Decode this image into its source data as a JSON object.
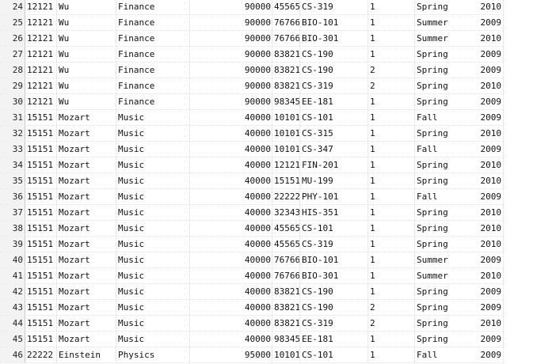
{
  "grid": {
    "rows": [
      {
        "rn": "24",
        "id": "12121",
        "name": "Wu",
        "dept": "Finance",
        "salary": "90000",
        "sid": "45565",
        "course": "CS-319",
        "sec": "1",
        "semester": "Spring",
        "year": "2010"
      },
      {
        "rn": "25",
        "id": "12121",
        "name": "Wu",
        "dept": "Finance",
        "salary": "90000",
        "sid": "76766",
        "course": "BIO-101",
        "sec": "1",
        "semester": "Summer",
        "year": "2009"
      },
      {
        "rn": "26",
        "id": "12121",
        "name": "Wu",
        "dept": "Finance",
        "salary": "90000",
        "sid": "76766",
        "course": "BIO-301",
        "sec": "1",
        "semester": "Summer",
        "year": "2010"
      },
      {
        "rn": "27",
        "id": "12121",
        "name": "Wu",
        "dept": "Finance",
        "salary": "90000",
        "sid": "83821",
        "course": "CS-190",
        "sec": "1",
        "semester": "Spring",
        "year": "2009"
      },
      {
        "rn": "28",
        "id": "12121",
        "name": "Wu",
        "dept": "Finance",
        "salary": "90000",
        "sid": "83821",
        "course": "CS-190",
        "sec": "2",
        "semester": "Spring",
        "year": "2009"
      },
      {
        "rn": "29",
        "id": "12121",
        "name": "Wu",
        "dept": "Finance",
        "salary": "90000",
        "sid": "83821",
        "course": "CS-319",
        "sec": "2",
        "semester": "Spring",
        "year": "2010"
      },
      {
        "rn": "30",
        "id": "12121",
        "name": "Wu",
        "dept": "Finance",
        "salary": "90000",
        "sid": "98345",
        "course": "EE-181",
        "sec": "1",
        "semester": "Spring",
        "year": "2009"
      },
      {
        "rn": "31",
        "id": "15151",
        "name": "Mozart",
        "dept": "Music",
        "salary": "40000",
        "sid": "10101",
        "course": "CS-101",
        "sec": "1",
        "semester": "Fall",
        "year": "2009"
      },
      {
        "rn": "32",
        "id": "15151",
        "name": "Mozart",
        "dept": "Music",
        "salary": "40000",
        "sid": "10101",
        "course": "CS-315",
        "sec": "1",
        "semester": "Spring",
        "year": "2010"
      },
      {
        "rn": "33",
        "id": "15151",
        "name": "Mozart",
        "dept": "Music",
        "salary": "40000",
        "sid": "10101",
        "course": "CS-347",
        "sec": "1",
        "semester": "Fall",
        "year": "2009"
      },
      {
        "rn": "34",
        "id": "15151",
        "name": "Mozart",
        "dept": "Music",
        "salary": "40000",
        "sid": "12121",
        "course": "FIN-201",
        "sec": "1",
        "semester": "Spring",
        "year": "2010"
      },
      {
        "rn": "35",
        "id": "15151",
        "name": "Mozart",
        "dept": "Music",
        "salary": "40000",
        "sid": "15151",
        "course": "MU-199",
        "sec": "1",
        "semester": "Spring",
        "year": "2010"
      },
      {
        "rn": "36",
        "id": "15151",
        "name": "Mozart",
        "dept": "Music",
        "salary": "40000",
        "sid": "22222",
        "course": "PHY-101",
        "sec": "1",
        "semester": "Fall",
        "year": "2009"
      },
      {
        "rn": "37",
        "id": "15151",
        "name": "Mozart",
        "dept": "Music",
        "salary": "40000",
        "sid": "32343",
        "course": "HIS-351",
        "sec": "1",
        "semester": "Spring",
        "year": "2010"
      },
      {
        "rn": "38",
        "id": "15151",
        "name": "Mozart",
        "dept": "Music",
        "salary": "40000",
        "sid": "45565",
        "course": "CS-101",
        "sec": "1",
        "semester": "Spring",
        "year": "2010"
      },
      {
        "rn": "39",
        "id": "15151",
        "name": "Mozart",
        "dept": "Music",
        "salary": "40000",
        "sid": "45565",
        "course": "CS-319",
        "sec": "1",
        "semester": "Spring",
        "year": "2010"
      },
      {
        "rn": "40",
        "id": "15151",
        "name": "Mozart",
        "dept": "Music",
        "salary": "40000",
        "sid": "76766",
        "course": "BIO-101",
        "sec": "1",
        "semester": "Summer",
        "year": "2009"
      },
      {
        "rn": "41",
        "id": "15151",
        "name": "Mozart",
        "dept": "Music",
        "salary": "40000",
        "sid": "76766",
        "course": "BIO-301",
        "sec": "1",
        "semester": "Summer",
        "year": "2010"
      },
      {
        "rn": "42",
        "id": "15151",
        "name": "Mozart",
        "dept": "Music",
        "salary": "40000",
        "sid": "83821",
        "course": "CS-190",
        "sec": "1",
        "semester": "Spring",
        "year": "2009"
      },
      {
        "rn": "43",
        "id": "15151",
        "name": "Mozart",
        "dept": "Music",
        "salary": "40000",
        "sid": "83821",
        "course": "CS-190",
        "sec": "2",
        "semester": "Spring",
        "year": "2009"
      },
      {
        "rn": "44",
        "id": "15151",
        "name": "Mozart",
        "dept": "Music",
        "salary": "40000",
        "sid": "83821",
        "course": "CS-319",
        "sec": "2",
        "semester": "Spring",
        "year": "2010"
      },
      {
        "rn": "45",
        "id": "15151",
        "name": "Mozart",
        "dept": "Music",
        "salary": "40000",
        "sid": "98345",
        "course": "EE-181",
        "sec": "1",
        "semester": "Spring",
        "year": "2009"
      },
      {
        "rn": "46",
        "id": "22222",
        "name": "Einstein",
        "dept": "Physics",
        "salary": "95000",
        "sid": "10101",
        "course": "CS-101",
        "sec": "1",
        "semester": "Fall",
        "year": "2009"
      }
    ]
  }
}
